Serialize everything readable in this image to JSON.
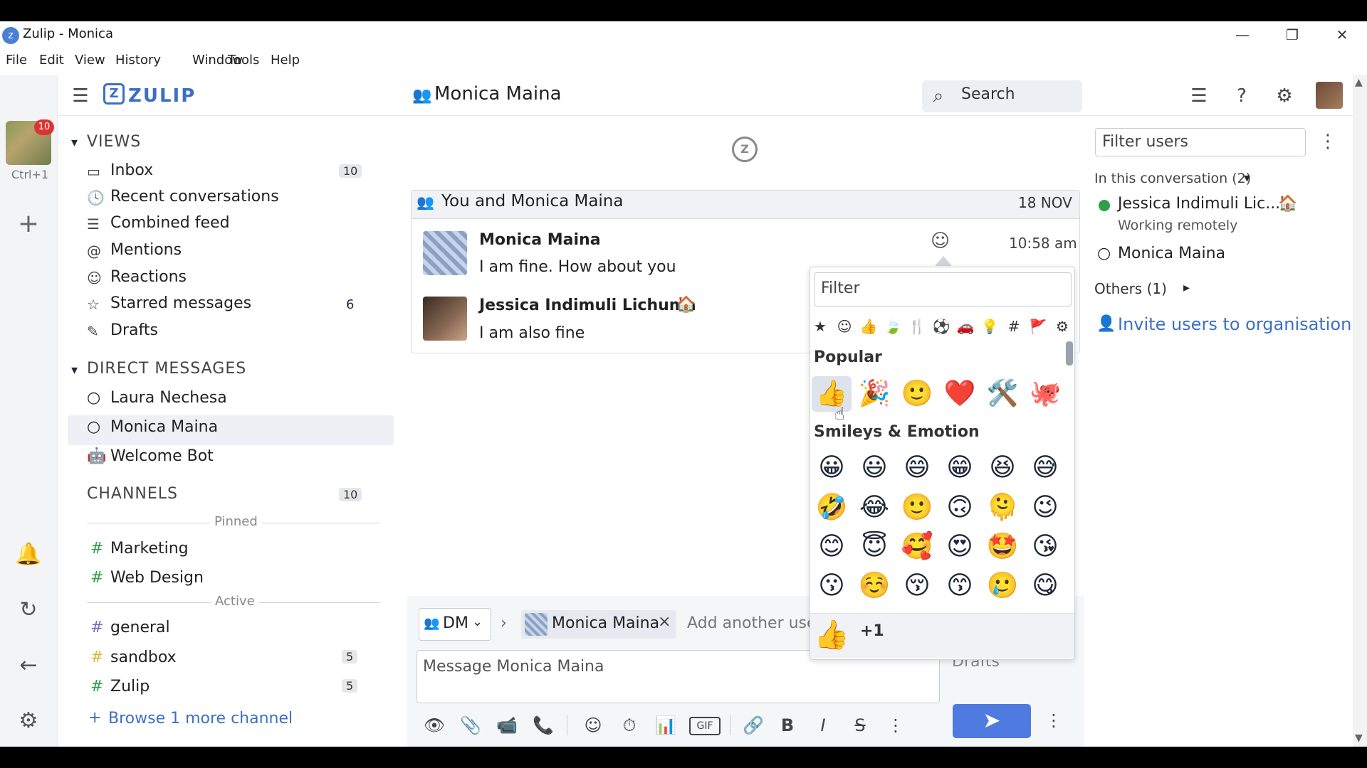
{
  "window": {
    "title": "Zulip - Monica",
    "minimize": "—",
    "restore": "❐",
    "close": "✕"
  },
  "menu": [
    "File",
    "Edit",
    "View",
    "History",
    "Window",
    "Tools",
    "Help"
  ],
  "rail": {
    "org_badge": "10",
    "org_shortcut": "Ctrl+1",
    "add": "+"
  },
  "header": {
    "logo": "ZULIP",
    "conversation_title": "Monica Maina",
    "search_placeholder": "Search"
  },
  "left_sidebar": {
    "views_label": "VIEWS",
    "views": [
      {
        "label": "Inbox",
        "count": "10",
        "icon": "inbox-icon"
      },
      {
        "label": "Recent conversations",
        "count": "",
        "icon": "clock-icon"
      },
      {
        "label": "Combined feed",
        "count": "",
        "icon": "feed-icon"
      },
      {
        "label": "Mentions",
        "count": "",
        "icon": "at-icon"
      },
      {
        "label": "Reactions",
        "count": "",
        "icon": "smile-icon"
      },
      {
        "label": "Starred messages",
        "count": "6",
        "icon": "star-icon"
      },
      {
        "label": "Drafts",
        "count": "",
        "icon": "drafts-icon"
      }
    ],
    "dm_label": "DIRECT MESSAGES",
    "direct_messages": [
      "Laura Nechesa",
      "Monica Maina",
      "Welcome Bot"
    ],
    "channels_label": "CHANNELS",
    "channels_count": "10",
    "pinned_label": "Pinned",
    "pinned": [
      {
        "name": "Marketing",
        "count": ""
      },
      {
        "name": "Web Design",
        "count": ""
      }
    ],
    "active_label": "Active",
    "active": [
      {
        "name": "general",
        "count": ""
      },
      {
        "name": "sandbox",
        "count": "5"
      },
      {
        "name": "Zulip",
        "count": "5"
      }
    ],
    "browse": "Browse 1 more channel"
  },
  "messages": {
    "recipient": "You and Monica Maina",
    "date": "18 NOV",
    "items": [
      {
        "sender": "Monica Maina",
        "text": "I am fine. How about you",
        "time": "10:58 am"
      },
      {
        "sender": "Jessica Indimuli Lichuma",
        "text": "I am also fine",
        "time": ""
      }
    ]
  },
  "emoji_picker": {
    "filter_placeholder": "Filter",
    "categories": [
      "★",
      "☺",
      "👍",
      "🍃",
      "🍴",
      "⚽",
      "🚗",
      "💡",
      "#",
      "🚩",
      "⚙"
    ],
    "popular_label": "Popular",
    "popular": [
      "👍",
      "🎉",
      "🙂",
      "❤️",
      "🛠️",
      "🐙"
    ],
    "smileys_label": "Smileys & Emotion",
    "smileys": [
      [
        "😀",
        "😃",
        "😄",
        "😁",
        "😆",
        "😅"
      ],
      [
        "🤣",
        "😂",
        "🙂",
        "🙃",
        "🫠",
        "😉"
      ],
      [
        "😊",
        "😇",
        "🥰",
        "😍",
        "🤩",
        "😘"
      ],
      [
        "😗",
        "☺️",
        "😚",
        "😙",
        "🥲",
        "😋"
      ]
    ],
    "footer_emoji": "👍",
    "footer_label": "+1"
  },
  "compose": {
    "dm_select": "DM",
    "recipient": "Monica Maina",
    "add_placeholder": "Add another user...",
    "message_placeholder": "Message Monica Maina",
    "drafts_label": "Drafts",
    "send_label": "➤",
    "tools": [
      "👁",
      "📎",
      "📹",
      "📞",
      "☺",
      "⏱",
      "📊",
      "GIF",
      "🔗",
      "B",
      "I",
      "S",
      "⋮"
    ]
  },
  "right_sidebar": {
    "filter_placeholder": "Filter users",
    "in_conversation": "In this conversation (2)",
    "users": [
      {
        "name": "Jessica Indimuli Lic...",
        "status": "Working remotely",
        "online": true
      },
      {
        "name": "Monica Maina",
        "status": "",
        "online": false
      }
    ],
    "others": "Others (1)",
    "invite": "Invite users to organisation"
  },
  "colors": {
    "accent": "#3b6fc7",
    "send": "#4f7ae0",
    "online": "#2e9e48"
  }
}
